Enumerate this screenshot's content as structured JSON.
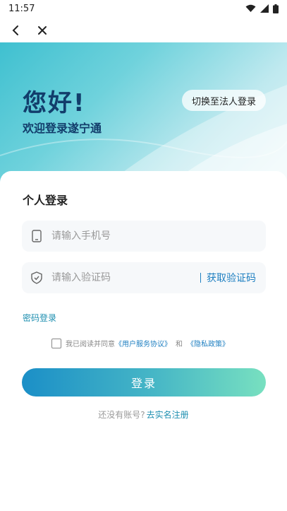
{
  "status_bar": {
    "time": "11:57"
  },
  "nav": {
    "back_icon": "chevron-left-icon",
    "close_icon": "close-icon"
  },
  "hero": {
    "title": "您好!",
    "subtitle": "欢迎登录遂宁通",
    "switch_label": "切换至法人登录"
  },
  "form": {
    "section_title": "个人登录",
    "phone_placeholder": "请输入手机号",
    "code_placeholder": "请输入验证码",
    "get_code_label": "获取验证码",
    "password_login_label": "密码登录",
    "agreement": {
      "prefix": "我已阅读并同意",
      "service_link": "《用户服务协议》",
      "and": "和",
      "privacy_link": "《隐私政策》"
    },
    "login_label": "登录",
    "register_prompt": "还没有账号?",
    "register_link": "去实名注册"
  },
  "colors": {
    "brand_blue": "#1e7fc1",
    "title_navy": "#123d6b",
    "gradient_start": "#1b8fc7",
    "gradient_end": "#78e0c0"
  }
}
